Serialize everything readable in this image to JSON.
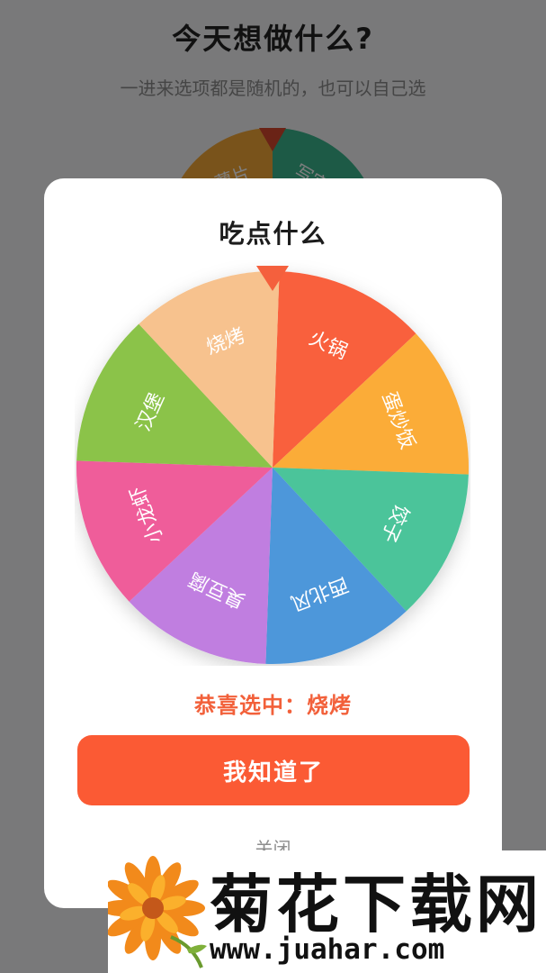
{
  "background": {
    "title": "今天想做什么?",
    "subtitle": "一进来选项都是随机的，也可以自己选",
    "wheel_labels": [
      "薯片",
      "写字"
    ]
  },
  "modal": {
    "title": "吃点什么",
    "wheel": {
      "segments": [
        {
          "label": "火锅",
          "color": "#f9603e"
        },
        {
          "label": "蛋炒饭",
          "color": "#fbac38"
        },
        {
          "label": "饺子",
          "color": "#4cc49a"
        },
        {
          "label": "西北风",
          "color": "#4e97da"
        },
        {
          "label": "臭豆腐",
          "color": "#c07ee0"
        },
        {
          "label": "小龙虾",
          "color": "#ef5d9a"
        },
        {
          "label": "汉堡",
          "color": "#8bc34a"
        },
        {
          "label": "烧烤",
          "color": "#f7c28e"
        }
      ],
      "pointer_color": "#f4603d"
    },
    "result_text": "恭喜选中：烧烤",
    "confirm_button": "我知道了",
    "close_link": "关闭"
  },
  "watermark": {
    "brand": "菊花下载网",
    "url": "www.juahar.com"
  },
  "colors": {
    "accent": "#fb5a34",
    "result": "#f2603a"
  }
}
